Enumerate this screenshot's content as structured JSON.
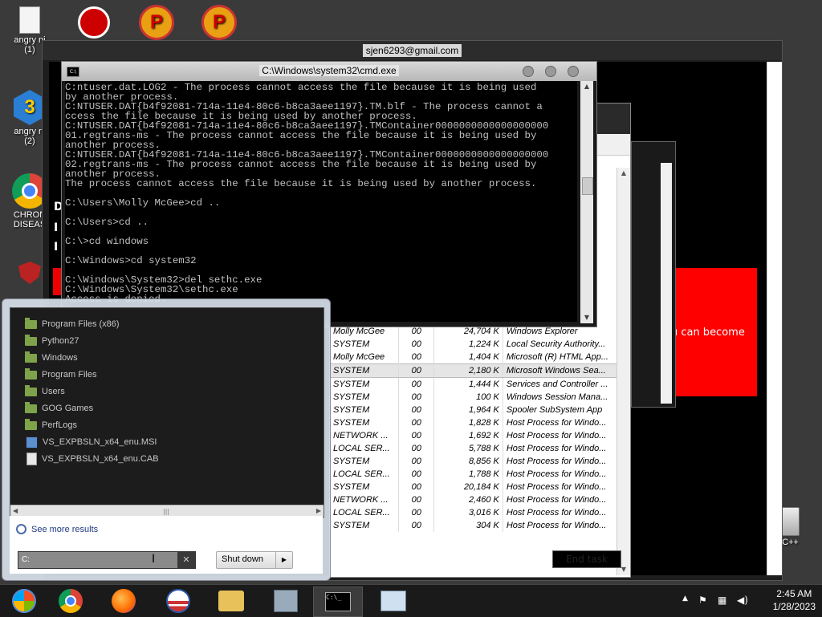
{
  "desktop": {
    "icons": [
      {
        "label": "angry ni\n(1)"
      },
      {
        "label": "angry ni\n(2)"
      },
      {
        "label": "CHRON\nDISEAS"
      },
      {
        "label": "n C++"
      }
    ]
  },
  "background_window": {
    "title": "sjen6293@gmail.com",
    "promo_text": "ou can become",
    "left_letters": [
      "D",
      "I",
      "I"
    ],
    "end_task_label": "End task"
  },
  "cmd": {
    "title": "C:\\Windows\\system32\\cmd.exe",
    "lines": [
      "C:ntuser.dat.LOG2 - The process cannot access the file because it is being used",
      "by another process.",
      "C:NTUSER.DAT{b4f92081-714a-11e4-80c6-b8ca3aee1197}.TM.blf - The process cannot a",
      "ccess the file because it is being used by another process.",
      "C:NTUSER.DAT{b4f92081-714a-11e4-80c6-b8ca3aee1197}.TMContainer0000000000000000000",
      "01.regtrans-ms - The process cannot access the file because it is being used by",
      "another process.",
      "C:NTUSER.DAT{b4f92081-714a-11e4-80c6-b8ca3aee1197}.TMContainer0000000000000000000",
      "02.regtrans-ms - The process cannot access the file because it is being used by",
      "another process.",
      "The process cannot access the file because it is being used by another process.",
      "",
      "C:\\Users\\Molly McGee>cd ..",
      "",
      "C:\\Users>cd ..",
      "",
      "C:\\>cd windows",
      "",
      "C:\\Windows>cd system32",
      "",
      "C:\\Windows\\System32>del sethc.exe",
      "C:\\Windows\\System32\\sethc.exe",
      "Access is denied."
    ]
  },
  "task_manager": {
    "rows": [
      {
        "user": "Molly McGee",
        "cpu": "00",
        "mem": "24,704 K",
        "desc": "Windows Explorer"
      },
      {
        "user": "SYSTEM",
        "cpu": "00",
        "mem": "1,224 K",
        "desc": "Local Security Authority..."
      },
      {
        "user": "Molly McGee",
        "cpu": "00",
        "mem": "1,404 K",
        "desc": "Microsoft (R) HTML App..."
      },
      {
        "user": "SYSTEM",
        "cpu": "00",
        "mem": "2,180 K",
        "desc": "Microsoft Windows Sea...",
        "selected": true
      },
      {
        "user": "SYSTEM",
        "cpu": "00",
        "mem": "1,444 K",
        "desc": "Services and Controller ..."
      },
      {
        "user": "SYSTEM",
        "cpu": "00",
        "mem": "100 K",
        "desc": "Windows Session Mana..."
      },
      {
        "user": "SYSTEM",
        "cpu": "00",
        "mem": "1,964 K",
        "desc": "Spooler SubSystem App"
      },
      {
        "user": "SYSTEM",
        "cpu": "00",
        "mem": "1,828 K",
        "desc": "Host Process for Windo..."
      },
      {
        "user": "NETWORK ...",
        "cpu": "00",
        "mem": "1,692 K",
        "desc": "Host Process for Windo..."
      },
      {
        "user": "LOCAL SER...",
        "cpu": "00",
        "mem": "5,788 K",
        "desc": "Host Process for Windo..."
      },
      {
        "user": "SYSTEM",
        "cpu": "00",
        "mem": "8,856 K",
        "desc": "Host Process for Windo..."
      },
      {
        "user": "LOCAL SER...",
        "cpu": "00",
        "mem": "1,788 K",
        "desc": "Host Process for Windo..."
      },
      {
        "user": "SYSTEM",
        "cpu": "00",
        "mem": "20,184 K",
        "desc": "Host Process for Windo..."
      },
      {
        "user": "NETWORK ...",
        "cpu": "00",
        "mem": "2,460 K",
        "desc": "Host Process for Windo..."
      },
      {
        "user": "LOCAL SER...",
        "cpu": "00",
        "mem": "3,016 K",
        "desc": "Host Process for Windo..."
      },
      {
        "user": "SYSTEM",
        "cpu": "00",
        "mem": "304 K",
        "desc": "Host Process for Windo..."
      }
    ]
  },
  "start_menu": {
    "items": [
      {
        "label": "Program Files (x86)",
        "icon": "folder-icon"
      },
      {
        "label": "Python27",
        "icon": "folder-icon"
      },
      {
        "label": "Windows",
        "icon": "folder-icon"
      },
      {
        "label": "Program Files",
        "icon": "folder-icon"
      },
      {
        "label": "Users",
        "icon": "folder-icon"
      },
      {
        "label": "GOG Games",
        "icon": "folder-icon"
      },
      {
        "label": "PerfLogs",
        "icon": "folder-icon"
      },
      {
        "label": "VS_EXPBSLN_x64_enu.MSI",
        "icon": "msi-file-icon"
      },
      {
        "label": "VS_EXPBSLN_x64_enu.CAB",
        "icon": "file-icon"
      }
    ],
    "see_more": "See more results",
    "search_value": "C:",
    "shutdown_label": "Shut down"
  },
  "taskbar": {
    "time": "2:45 AM",
    "date": "1/28/2023",
    "apps": [
      "start-orb-icon",
      "chrome-icon",
      "firefox-icon",
      "ie-icon",
      "explorer-icon",
      "control-panel-icon",
      "cmd-icon",
      "task-manager-icon"
    ]
  }
}
